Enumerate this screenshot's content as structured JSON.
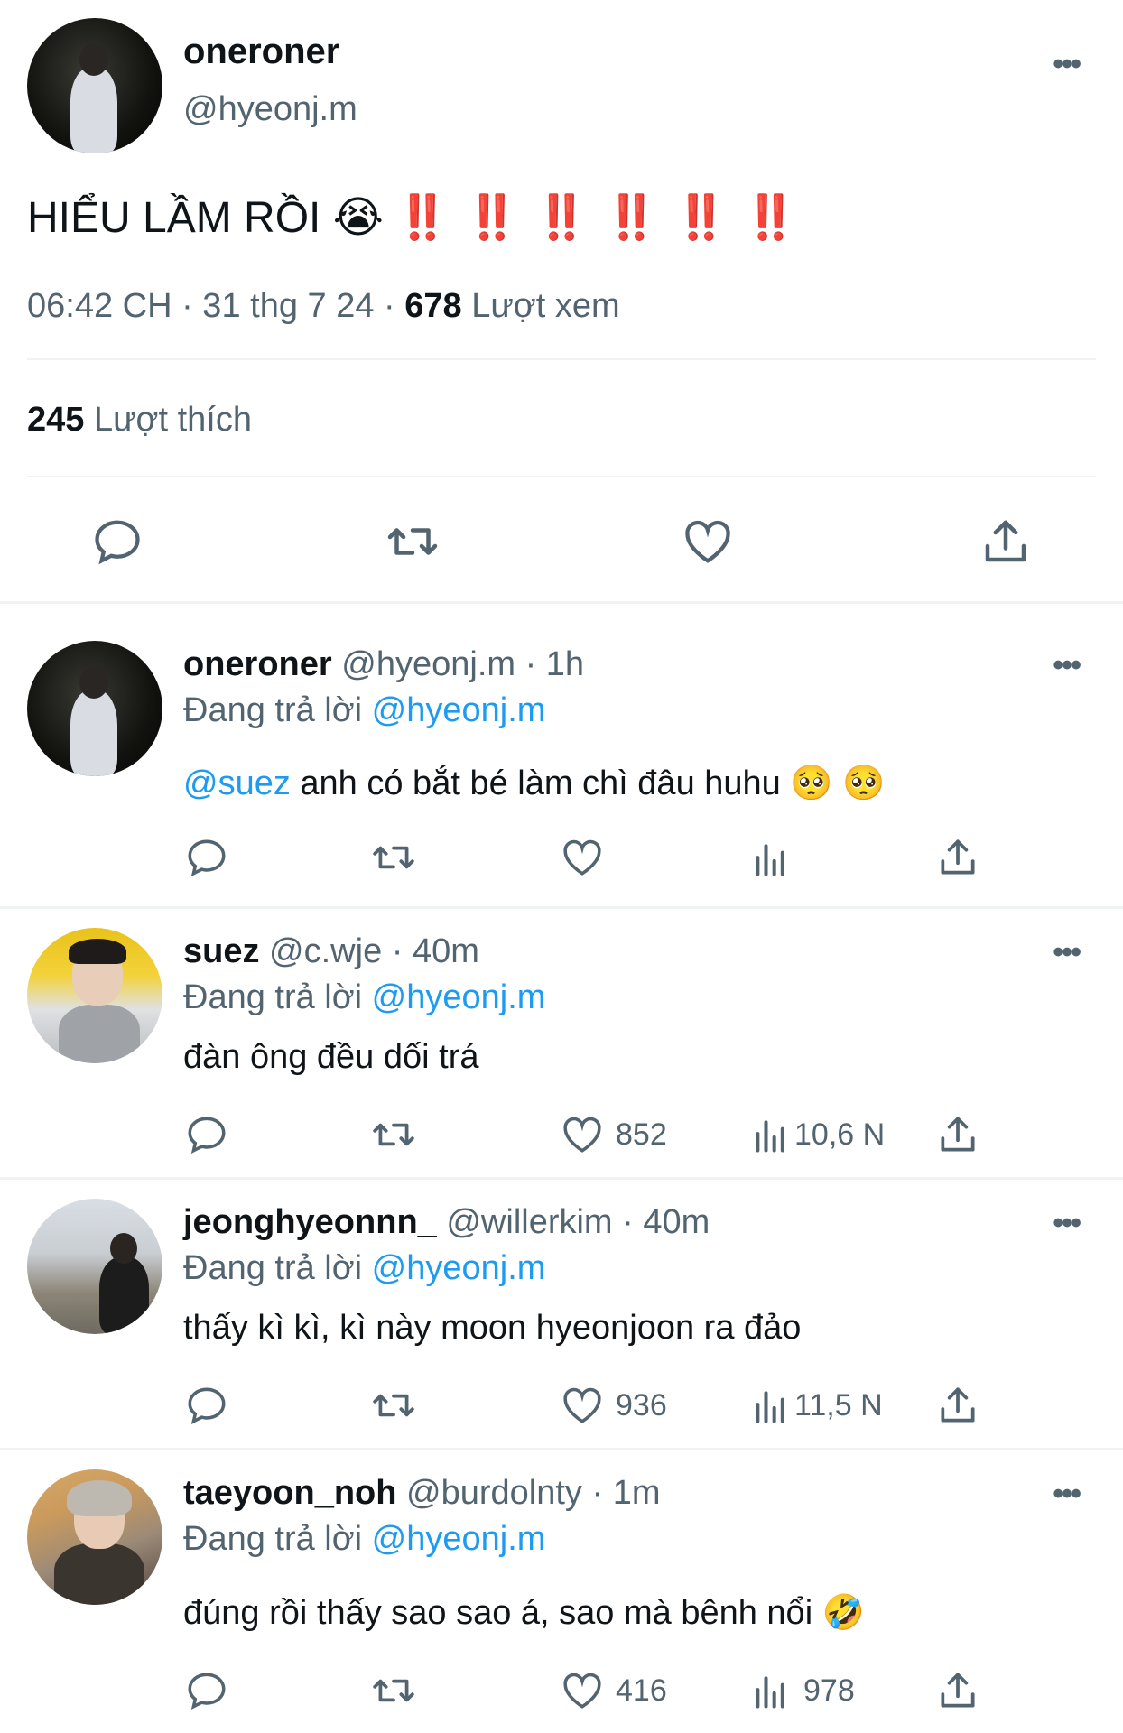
{
  "main_tweet": {
    "display_name": "oneroner",
    "handle": "@hyeonj.m",
    "text": "HIỂU LẦM RỒI",
    "emoji_cry": "😭",
    "bangs": "‼️ ‼️ ‼️ ‼️ ‼️ ‼️",
    "time": "06:42 CH · 31 thg 7 24 ·",
    "views_count": "678",
    "views_label": "Lượt xem",
    "likes_count": "245",
    "likes_label": "Lượt thích"
  },
  "replies": [
    {
      "display_name": "oneroner",
      "meta": "@hyeonj.m · 1h",
      "replying_prefix": "Đang trả lời",
      "replying_to": "@hyeonj.m",
      "mention": "@suez",
      "text": "anh có bắt bé làm chì đâu huhu 🥺 🥺",
      "likes": "",
      "views": ""
    },
    {
      "display_name": "suez",
      "meta": "@c.wje · 40m",
      "replying_prefix": "Đang trả lời",
      "replying_to": "@hyeonj.m",
      "text": "đàn ông đều dối trá",
      "likes": "852",
      "views": "10,6 N"
    },
    {
      "display_name": "jeonghyeonnn_",
      "meta": "@willerkim · 40m",
      "replying_prefix": "Đang trả lời",
      "replying_to": "@hyeonj.m",
      "text": "thấy kì kì, kì này moon hyeonjoon ra đảo",
      "likes": "936",
      "views": "11,5 N"
    },
    {
      "display_name": "taeyoon_noh",
      "meta": "@burdolnty · 1m",
      "replying_prefix": "Đang trả lời",
      "replying_to": "@hyeonj.m",
      "text": "đúng rồi thấy sao sao á, sao mà bênh nổi 🤣",
      "likes": "416",
      "views": "978"
    }
  ],
  "more_glyph": "•••",
  "colors": {
    "accent": "#1d9bf0",
    "muted": "#536471",
    "text": "#0f1419",
    "divider": "#eff3f4"
  }
}
